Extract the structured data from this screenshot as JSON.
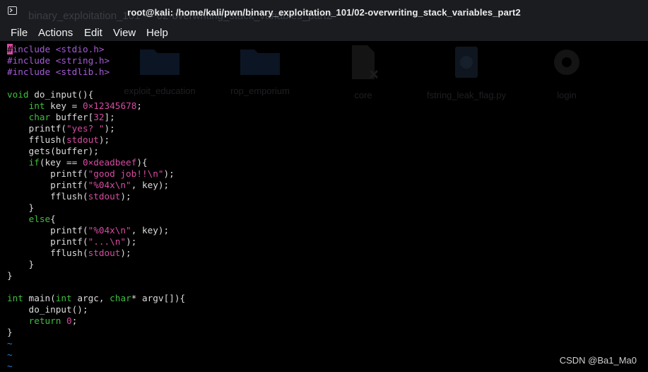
{
  "window": {
    "title": "root@kali: /home/kali/pwn/binary_exploitation_101/02-overwriting_stack_variables_part2",
    "ghost_title": "binary_exploitation_101 — 02-overwriting_stack_variables_part2"
  },
  "menu": [
    "File",
    "Actions",
    "Edit",
    "View",
    "Help"
  ],
  "desktop_icons": [
    {
      "label": "exploit_education",
      "icon": "folder-icon"
    },
    {
      "label": "rop_emporium",
      "icon": "folder-icon"
    },
    {
      "label": "core",
      "icon": "broken-file-icon"
    },
    {
      "label": "fstring_leak_flag.py",
      "icon": "python-file-icon"
    },
    {
      "label": "login",
      "icon": "gear-executable-icon"
    }
  ],
  "code_lines": [
    [
      {
        "t": "#",
        "c": "cur"
      },
      {
        "t": "include <stdio.h>",
        "c": "pp"
      }
    ],
    [
      {
        "t": "#include <string.h>",
        "c": "pp"
      }
    ],
    [
      {
        "t": "#include <stdlib.h>",
        "c": "pp"
      }
    ],
    [],
    [
      {
        "t": "void",
        "c": "k"
      },
      {
        "t": " do_input(){"
      }
    ],
    [
      {
        "t": "    "
      },
      {
        "t": "int",
        "c": "k"
      },
      {
        "t": " key = "
      },
      {
        "t": "0×12345678",
        "c": "s"
      },
      {
        "t": ";"
      }
    ],
    [
      {
        "t": "    "
      },
      {
        "t": "char",
        "c": "k"
      },
      {
        "t": " buffer["
      },
      {
        "t": "32",
        "c": "s"
      },
      {
        "t": "];"
      }
    ],
    [
      {
        "t": "    printf("
      },
      {
        "t": "\"yes? \"",
        "c": "s"
      },
      {
        "t": ");"
      }
    ],
    [
      {
        "t": "    fflush("
      },
      {
        "t": "stdout",
        "c": "s"
      },
      {
        "t": ");"
      }
    ],
    [
      {
        "t": "    gets(buffer);"
      }
    ],
    [
      {
        "t": "    "
      },
      {
        "t": "if",
        "c": "k"
      },
      {
        "t": "(key == "
      },
      {
        "t": "0×deadbeef",
        "c": "s"
      },
      {
        "t": "){"
      }
    ],
    [
      {
        "t": "        printf("
      },
      {
        "t": "\"good job!!\\n\"",
        "c": "s"
      },
      {
        "t": ");"
      }
    ],
    [
      {
        "t": "        printf("
      },
      {
        "t": "\"%04x\\n\"",
        "c": "s"
      },
      {
        "t": ", key);"
      }
    ],
    [
      {
        "t": "        fflush("
      },
      {
        "t": "stdout",
        "c": "s"
      },
      {
        "t": ");"
      }
    ],
    [
      {
        "t": "    }"
      }
    ],
    [
      {
        "t": "    "
      },
      {
        "t": "else",
        "c": "k"
      },
      {
        "t": "{"
      }
    ],
    [
      {
        "t": "        printf("
      },
      {
        "t": "\"%04x\\n\"",
        "c": "s"
      },
      {
        "t": ", key);"
      }
    ],
    [
      {
        "t": "        printf("
      },
      {
        "t": "\"...\\n\"",
        "c": "s"
      },
      {
        "t": ");"
      }
    ],
    [
      {
        "t": "        fflush("
      },
      {
        "t": "stdout",
        "c": "s"
      },
      {
        "t": ");"
      }
    ],
    [
      {
        "t": "    }"
      }
    ],
    [
      {
        "t": "}"
      }
    ],
    [],
    [
      {
        "t": "int",
        "c": "k"
      },
      {
        "t": " main("
      },
      {
        "t": "int",
        "c": "k"
      },
      {
        "t": " argc, "
      },
      {
        "t": "char",
        "c": "k"
      },
      {
        "t": "* argv[]){"
      }
    ],
    [
      {
        "t": "    do_input();"
      }
    ],
    [
      {
        "t": "    "
      },
      {
        "t": "return",
        "c": "k"
      },
      {
        "t": " "
      },
      {
        "t": "0",
        "c": "s"
      },
      {
        "t": ";"
      }
    ],
    [
      {
        "t": "}"
      }
    ],
    [
      {
        "t": "~",
        "c": "tilde"
      }
    ],
    [
      {
        "t": "~",
        "c": "tilde"
      }
    ],
    [
      {
        "t": "~",
        "c": "tilde"
      }
    ]
  ],
  "watermark": "CSDN @Ba1_Ma0",
  "colors": {
    "keyword": "#3fbf3f",
    "string_number": "#d74aa1",
    "preprocessor": "#a55bd6",
    "tilde": "#2a7fd4",
    "background": "#000000",
    "titlebar": "#1a1c20"
  }
}
